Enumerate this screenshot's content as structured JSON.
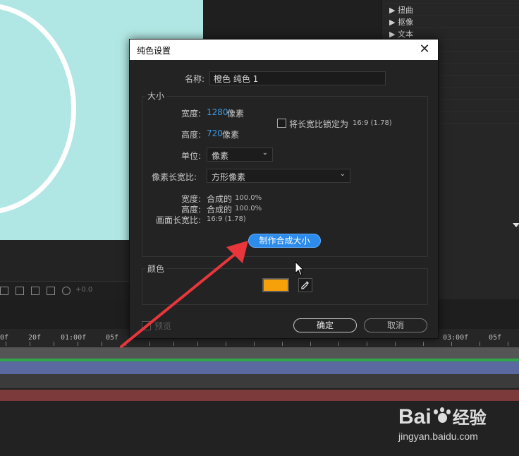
{
  "effects_panel": {
    "items": [
      "扭曲",
      "抠像",
      "文本"
    ],
    "arrow": "▶"
  },
  "viewer_toolbar": {
    "exposure_value": "+0.0"
  },
  "timeline": {
    "ruler_labels": [
      "0f",
      "20f",
      "01:00f",
      "05f",
      "03:00f",
      "05f"
    ]
  },
  "dialog": {
    "title": "纯色设置",
    "name_label": "名称:",
    "name_value": "橙色 纯色 1",
    "size_group": "大小",
    "width_label": "宽度:",
    "width_value": "1280",
    "width_unit": "像素",
    "height_label": "高度:",
    "height_value": "720",
    "height_unit": "像素",
    "lock_ratio_label": "将长宽比锁定为",
    "lock_ratio_value": "16:9 (1.78)",
    "units_label": "单位:",
    "units_value": "像素",
    "pixel_aspect_label": "像素长宽比:",
    "pixel_aspect_value": "方形像素",
    "info_width_label": "宽度:",
    "info_width_value": "合成的",
    "info_width_percent": "100.0%",
    "info_height_label": "高度:",
    "info_height_value": "合成的",
    "info_height_percent": "100.0%",
    "info_frame_label": "画面长宽比:",
    "info_frame_value": "16:9 (1.78)",
    "make_comp_size": "制作合成大小",
    "color_group": "颜色",
    "color_hex": "#f7a10a",
    "preview_label": "预览",
    "ok": "确定",
    "cancel": "取消"
  },
  "watermark": {
    "brand": "Bai",
    "brand_suffix": "经验",
    "url": "jingyan.baidu.com"
  }
}
